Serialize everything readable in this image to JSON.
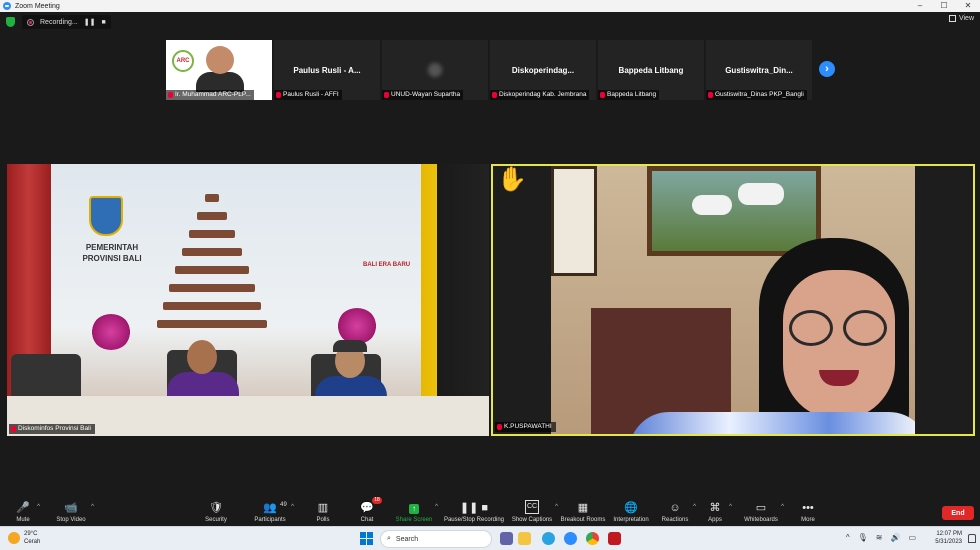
{
  "window": {
    "title": "Zoom Meeting",
    "controls": [
      "–",
      "☐",
      "✕"
    ]
  },
  "recording": {
    "label": "Recording...",
    "pause": "❚❚",
    "stop": "■"
  },
  "view": {
    "label": "View"
  },
  "gallery": [
    {
      "name": "",
      "label": "Ir. Muhammad ARC-PLP...",
      "has_video": true,
      "logo": "ARC"
    },
    {
      "name": "Paulus Rusli - A...",
      "label": "Paulus Rusli - AFFI"
    },
    {
      "name": "",
      "label": "UNUD-Wayan Supartha",
      "blurred": true
    },
    {
      "name": "Diskoperindag...",
      "label": "Diskoperindag Kab. Jembrana"
    },
    {
      "name": "Bappeda Litbang",
      "label": "Bappeda Litbang"
    },
    {
      "name": "Gustiswitra_Din...",
      "label": "Gustiswitra_Dinas PKP_Bangli"
    }
  ],
  "next_page": "›",
  "main_videos": {
    "left": {
      "label": "Diskominfos Provinsi Bali",
      "banner_text": "PEMERINTAH\nPROVINSI BALI",
      "banner_slogan": "BALI ERA BARU"
    },
    "right": {
      "label": "K.PUSPAWATHI",
      "raised_hand": "✋"
    }
  },
  "toolbar": {
    "items": [
      {
        "label": "Mute",
        "icon": "🎤",
        "caret": true
      },
      {
        "label": "Stop Video",
        "icon": "📹",
        "caret": true
      },
      {
        "label": "Security",
        "icon": "🛡"
      },
      {
        "label": "Participants",
        "icon": "👥",
        "count": "49",
        "caret": true
      },
      {
        "label": "Polls",
        "icon": "▥"
      },
      {
        "label": "Chat",
        "icon": "💬",
        "badge": "18"
      },
      {
        "label": "Share Screen",
        "icon": "↑",
        "caret": true,
        "accent": true
      },
      {
        "label": "Pause/Stop Recording",
        "icon": "❚❚ ■"
      },
      {
        "label": "Show Captions",
        "icon": "CC",
        "caret": true
      },
      {
        "label": "Breakout Rooms",
        "icon": "▦"
      },
      {
        "label": "Interpretation",
        "icon": "🌐"
      },
      {
        "label": "Reactions",
        "icon": "☺",
        "caret": true
      },
      {
        "label": "Apps",
        "icon": "⌘",
        "caret": true
      },
      {
        "label": "Whiteboards",
        "icon": "▭",
        "caret": true
      },
      {
        "label": "More",
        "icon": "•••"
      }
    ],
    "end_label": "End"
  },
  "taskbar": {
    "weather": {
      "temp": "29°C",
      "condition": "Cerah"
    },
    "search_placeholder": "Search",
    "tray_caret": "^",
    "clock": {
      "time": "12:07 PM",
      "date": "5/31/2023"
    }
  },
  "colors": {
    "accent_blue": "#2d8cff",
    "active_speaker": "#e6e64a",
    "end_red": "#e02828",
    "share_green": "#1fb141"
  }
}
